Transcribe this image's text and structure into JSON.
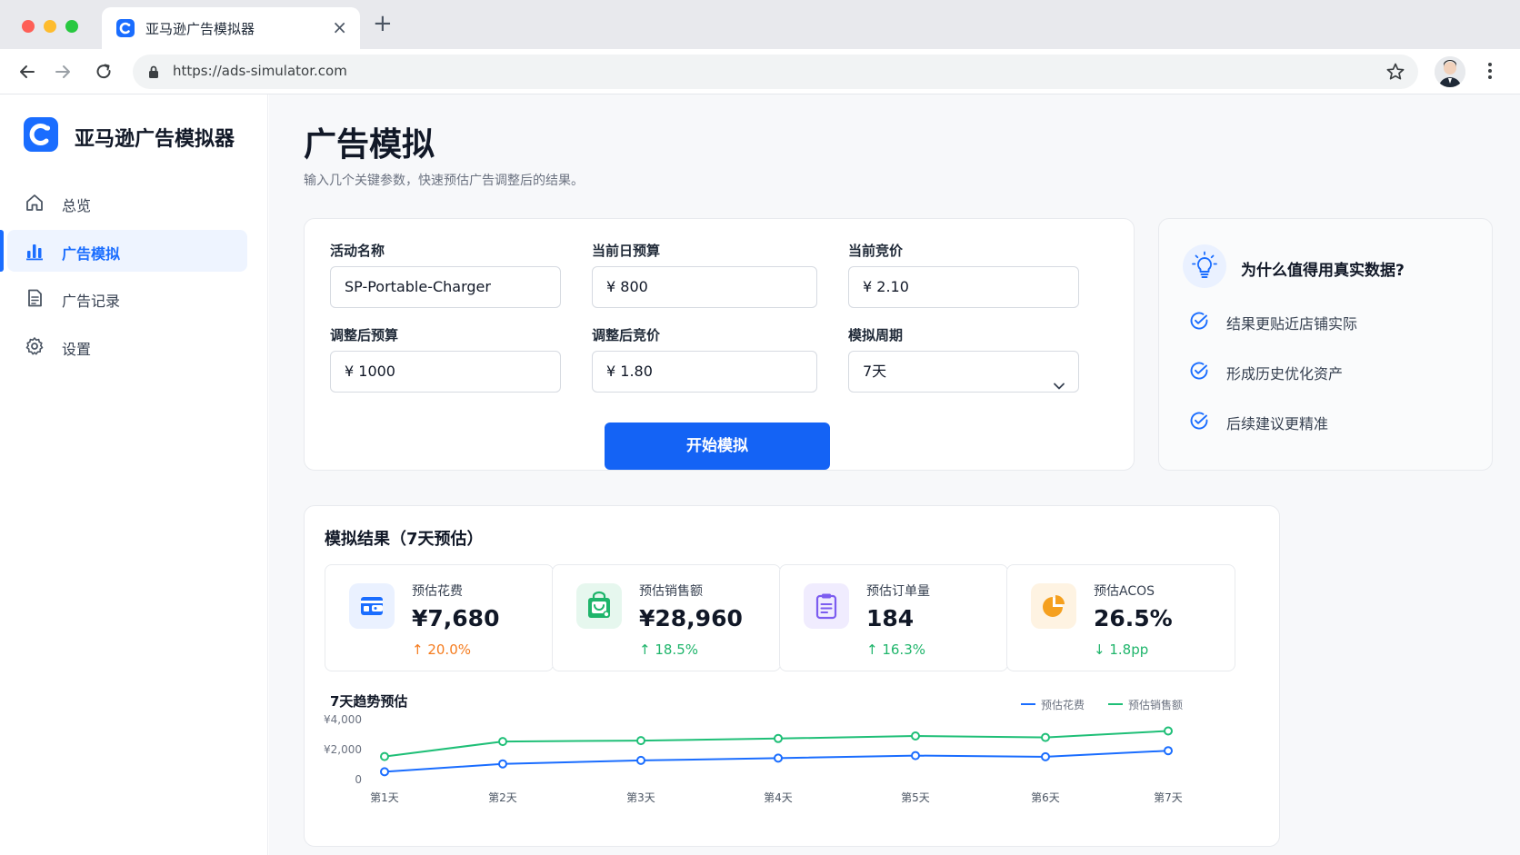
{
  "browser": {
    "tab_title": "亚马逊广告模拟器",
    "url": "https://ads-simulator.com"
  },
  "sidebar": {
    "brand": "亚马逊广告模拟器",
    "items": [
      {
        "label": "总览",
        "icon": "home-icon",
        "active": false
      },
      {
        "label": "广告模拟",
        "icon": "bar-chart-icon",
        "active": true
      },
      {
        "label": "广告记录",
        "icon": "document-icon",
        "active": false
      },
      {
        "label": "设置",
        "icon": "gear-icon",
        "active": false
      }
    ]
  },
  "page": {
    "title": "广告模拟",
    "subtitle": "输入几个关键参数，快速预估广告调整后的结果。"
  },
  "form": {
    "campaign_label": "活动名称",
    "campaign_value": "SP-Portable-Charger",
    "daily_budget_label": "当前日预算",
    "daily_budget_value": "¥ 800",
    "current_bid_label": "当前竞价",
    "current_bid_value": "¥ 2.10",
    "new_budget_label": "调整后预算",
    "new_budget_value": "¥ 1000",
    "new_bid_label": "调整后竞价",
    "new_bid_value": "¥ 1.80",
    "period_label": "模拟周期",
    "period_value": "7天",
    "submit_label": "开始模拟"
  },
  "why": {
    "title": "为什么值得用真实数据?",
    "items": [
      "结果更贴近店铺实际",
      "形成历史优化资产",
      "后续建议更精准"
    ]
  },
  "results": {
    "title": "模拟结果（7天预估）",
    "stats": [
      {
        "label": "预估花费",
        "value": "¥7,680",
        "delta": "↑ 20.0%",
        "icon": "wallet-icon",
        "color": "#1a6dff"
      },
      {
        "label": "预估销售额",
        "value": "¥28,960",
        "delta": "↑ 18.5%",
        "icon": "shopping-bag-icon",
        "color": "#1fb56b"
      },
      {
        "label": "预估订单量",
        "value": "184",
        "delta": "↑ 16.3%",
        "icon": "clipboard-icon",
        "color": "#7c5cf0"
      },
      {
        "label": "预估ACOS",
        "value": "26.5%",
        "delta": "↓ 1.8pp",
        "icon": "pie-chart-icon",
        "color": "#f5a01f"
      }
    ],
    "chart_title": "7天趋势预估"
  },
  "chart_data": {
    "type": "line",
    "title": "7天趋势预估",
    "categories": [
      "第1天",
      "第2天",
      "第3天",
      "第4天",
      "第5天",
      "第6天",
      "第7天"
    ],
    "series": [
      {
        "name": "预估花费",
        "color": "#1a6dff",
        "values": [
          520,
          1050,
          1280,
          1430,
          1600,
          1520,
          1930
        ]
      },
      {
        "name": "预估销售额",
        "color": "#1fbf77",
        "values": [
          1540,
          2540,
          2600,
          2740,
          2910,
          2810,
          3240
        ]
      }
    ],
    "yticks": [
      "0",
      "¥2,000",
      "¥4,000"
    ],
    "ylim": [
      0,
      4000
    ],
    "legend": "top-right",
    "grid": false
  }
}
